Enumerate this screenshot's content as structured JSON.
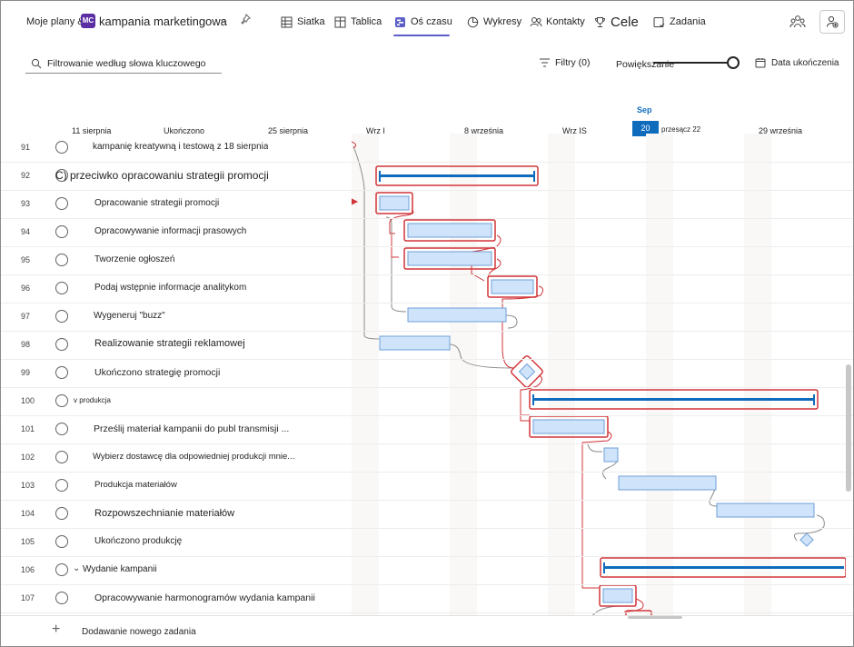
{
  "header": {
    "breadcrumb": "Moje plany &",
    "plan_badge": "MC",
    "plan_name": "kampania marketingowa",
    "nav": [
      {
        "label": "Siatka",
        "icon": "grid-icon"
      },
      {
        "label": "Tablica",
        "icon": "board-icon"
      },
      {
        "label": "Oś czasu",
        "icon": "timeline-icon",
        "active": true
      },
      {
        "label": "Wykresy",
        "icon": "chart-icon"
      },
      {
        "label": "Kontakty",
        "icon": "people-icon"
      },
      {
        "label": "Cele",
        "icon": "trophy-icon"
      },
      {
        "label": "Zadania",
        "icon": "tasks-icon"
      }
    ],
    "accent": "#5b5fc7"
  },
  "toolbar": {
    "search_placeholder": "Filtrowanie według słowa kluczowego",
    "filter_label": "Filtry (0)",
    "zoom_label": "Powiększanie",
    "zoom_level": 1.0,
    "due_date_label": "Data ukończenia"
  },
  "timeline": {
    "month": "Sep",
    "today": "20",
    "today_sub": "przesącz 22",
    "dates": [
      "11 sierpnia",
      "Ukończono",
      "25 sierpnia",
      "Wrz I",
      "8 września",
      "Wrz IS",
      "29 września"
    ]
  },
  "tasks": [
    {
      "num": "91",
      "name": "kampanię kreatywną i testową z 18 sierpnia"
    },
    {
      "num": "92",
      "name": "C) przeciwko opracowaniu strategii promocji"
    },
    {
      "num": "93",
      "name": "Opracowanie strategii promocji"
    },
    {
      "num": "94",
      "name": "Opracowywanie informacji prasowych"
    },
    {
      "num": "95",
      "name": "Tworzenie ogłoszeń"
    },
    {
      "num": "96",
      "name": "Podaj wstępnie informacje analitykom"
    },
    {
      "num": "97",
      "name": "Wygeneruj \"buzz\""
    },
    {
      "num": "98",
      "name": "Realizowanie strategii reklamowej"
    },
    {
      "num": "99",
      "name": "Ukończono strategię promocji"
    },
    {
      "num": "100",
      "name": "v produkcja"
    },
    {
      "num": "101",
      "name": "Prześlij materiał kampanii do publ transmisji ..."
    },
    {
      "num": "102",
      "name": "Wybierz dostawcę dla odpowiedniej produkcji mnie..."
    },
    {
      "num": "103",
      "name": "Produkcja materiałów"
    },
    {
      "num": "104",
      "name": "Rozpowszechnianie materiałów"
    },
    {
      "num": "105",
      "name": "Ukończono produkcję"
    },
    {
      "num": "106",
      "name": "Wydanie kampanii"
    },
    {
      "num": "107",
      "name": "Opracowywanie harmonogramów wydania kampanii"
    }
  ],
  "footer": {
    "add_task": "Dodawanie nowego zadania"
  },
  "colors": {
    "critical": "#d13438",
    "bar_fill": "#cfe4fa",
    "bar_border": "#6f9fd8",
    "summary": "#0f6cbd",
    "link_gray": "#8a8a8a"
  }
}
